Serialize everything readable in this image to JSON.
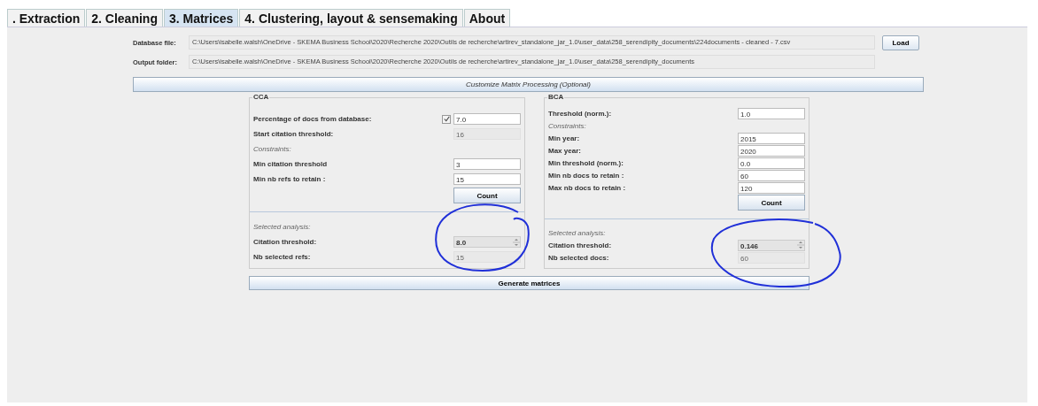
{
  "tabs": [
    {
      "label": ". Extraction",
      "selected": false
    },
    {
      "label": "2. Cleaning",
      "selected": false
    },
    {
      "label": "3. Matrices",
      "selected": true
    },
    {
      "label": "4. Clustering, layout & sensemaking",
      "selected": false
    },
    {
      "label": "About",
      "selected": false
    }
  ],
  "files": [
    {
      "label": "Database file:",
      "value": "C:\\Users\\isabelle.walsh\\OneDrive - SKEMA Business School\\2020\\Recherche 2020\\Outils de recherche\\artirev_standalone_jar_1.0\\user_data\\258_serendipity_documents\\224documents - cleaned - 7.csv",
      "button": "Load"
    },
    {
      "label": "Output folder:",
      "value": "C:\\Users\\isabelle.walsh\\OneDrive - SKEMA Business School\\2020\\Recherche 2020\\Outils de recherche\\artirev_standalone_jar_1.0\\user_data\\258_serendipity_documents"
    }
  ],
  "customize_button": "Customize Matrix Processing (Optional)",
  "panels": [
    {
      "title": "CCA",
      "rows": [
        {
          "kind": "input",
          "label": "Percentage of docs from database:",
          "value": "7.0",
          "checked": true
        },
        {
          "kind": "readout",
          "label": "Start citation threshold:",
          "value": "16"
        },
        {
          "kind": "note",
          "label": "Constraints:"
        },
        {
          "kind": "input",
          "label": "Min citation threshold",
          "value": "3"
        },
        {
          "kind": "input",
          "label": "Min nb refs to retain :",
          "value": "15"
        },
        {
          "kind": "button",
          "label": "Count"
        },
        {
          "kind": "separator"
        },
        {
          "kind": "note",
          "label": "Selected analysis:"
        },
        {
          "kind": "spinner",
          "label": "Citation threshold:",
          "value": "8.0"
        },
        {
          "kind": "readout",
          "label": "Nb selected refs:",
          "value": "15"
        }
      ]
    },
    {
      "title": "BCA",
      "rows": [
        {
          "kind": "input",
          "label": "Threshold (norm.):",
          "value": "1.0"
        },
        {
          "kind": "note",
          "label": "Constraints:"
        },
        {
          "kind": "input",
          "label": "Min year:",
          "value": "2015"
        },
        {
          "kind": "input",
          "label": "Max year:",
          "value": "2020"
        },
        {
          "kind": "input",
          "label": "Min threshold (norm.):",
          "value": "0.0"
        },
        {
          "kind": "input",
          "label": "Min nb docs to retain :",
          "value": "60"
        },
        {
          "kind": "input",
          "label": "Max nb docs to retain :",
          "value": "120"
        },
        {
          "kind": "button",
          "label": "Count"
        },
        {
          "kind": "separator"
        },
        {
          "kind": "note",
          "label": "Selected analysis:"
        },
        {
          "kind": "spinner",
          "label": "Citation threshold:",
          "value": "0.146"
        },
        {
          "kind": "readout",
          "label": "Nb selected docs:",
          "value": "60"
        }
      ]
    }
  ],
  "generate_button": "Generate matrices"
}
